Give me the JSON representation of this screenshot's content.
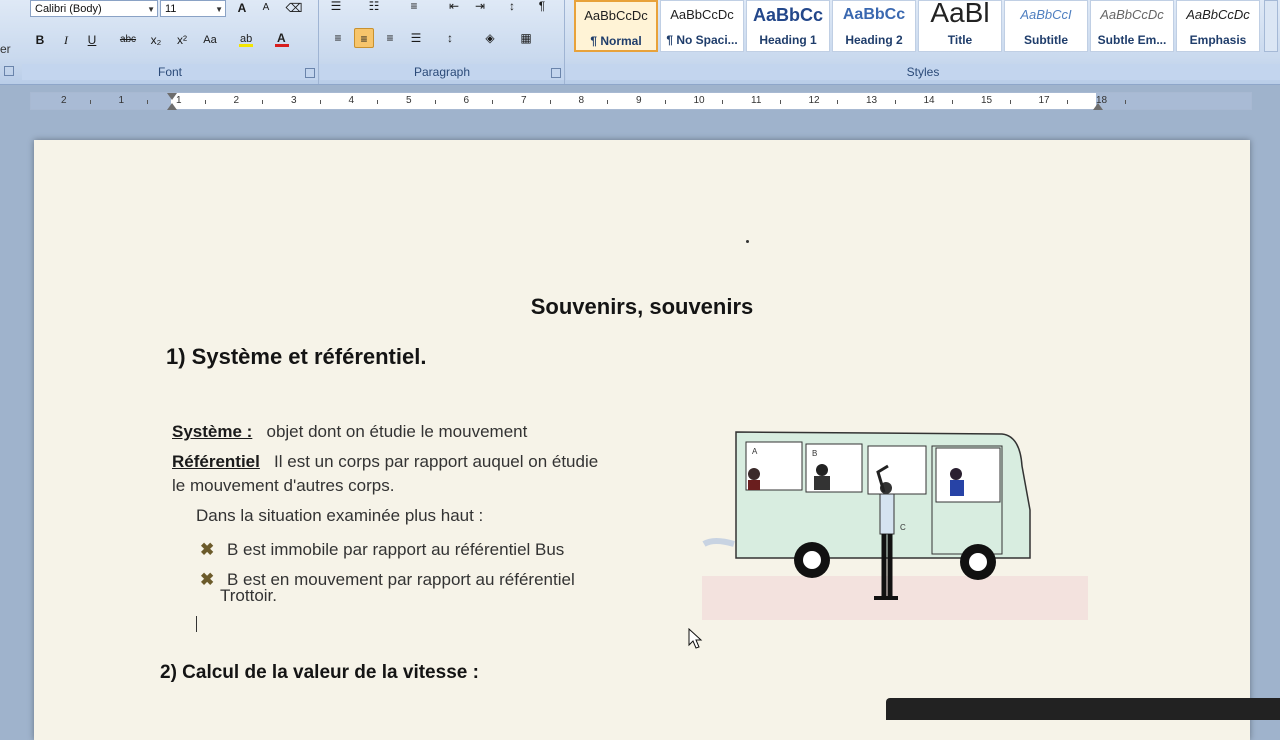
{
  "ribbon": {
    "left_edge_label": "er",
    "font": {
      "family": "Calibri (Body)",
      "size": "11",
      "group_label": "Font",
      "buttons": [
        "B",
        "I",
        "U",
        "abc",
        "x₂",
        "x²",
        "Aa"
      ]
    },
    "paragraph": {
      "group_label": "Paragraph"
    },
    "styles": {
      "group_label": "Styles",
      "tiles": [
        {
          "sample": "AaBbCcDc",
          "name": "¶ Normal"
        },
        {
          "sample": "AaBbCcDc",
          "name": "¶ No Spaci..."
        },
        {
          "sample": "AaBbCc",
          "name": "Heading 1"
        },
        {
          "sample": "AaBbCc",
          "name": "Heading 2"
        },
        {
          "sample": "AaBl",
          "name": "Title"
        },
        {
          "sample": "AaBbCcI",
          "name": "Subtitle"
        },
        {
          "sample": "AaBbCcDc",
          "name": "Subtle Em..."
        },
        {
          "sample": "AaBbCcDc",
          "name": "Emphasis"
        }
      ]
    }
  },
  "ruler": {
    "numbers": [
      "2",
      "1",
      "1",
      "2",
      "3",
      "4",
      "5",
      "6",
      "7",
      "8",
      "9",
      "10",
      "11",
      "12",
      "13",
      "14",
      "15",
      "17",
      "18"
    ]
  },
  "document": {
    "title": "Souvenirs, souvenirs",
    "section1": "1) Système et référentiel.",
    "systeme_term": "Système :",
    "systeme_def": "objet dont on étudie le mouvement",
    "referentiel_term": "Référentiel",
    "referentiel_def_1": "Il est un corps par rapport auquel on étudie",
    "referentiel_def_2": "le mouvement d'autres corps.",
    "situation": "Dans la situation examinée plus haut :",
    "bullet1": "B est immobile par rapport au référentiel Bus",
    "bullet2_1": "B est en mouvement par rapport au référentiel",
    "bullet2_2": "Trottoir.",
    "section2": "2) Calcul de la valeur de la vitesse :",
    "figure_labels": [
      "A",
      "B",
      "C"
    ]
  },
  "colors": {
    "page": "#f6f3e8",
    "ribbon": "#c9d9ee",
    "selected_style": "#e8a23a",
    "bus_body": "#d8ede0"
  }
}
